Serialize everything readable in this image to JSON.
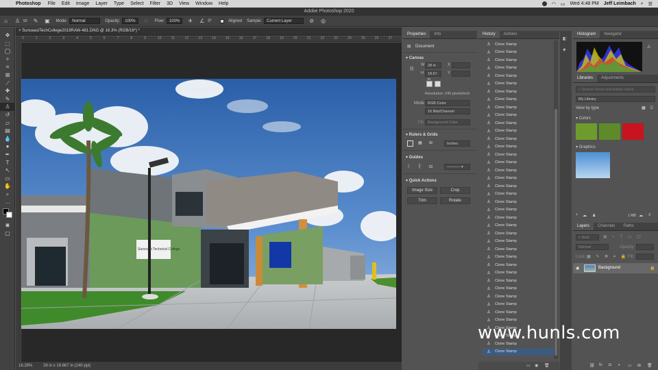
{
  "menubar": {
    "app": "Photoshop",
    "menus": [
      "File",
      "Edit",
      "Image",
      "Layer",
      "Type",
      "Select",
      "Filter",
      "3D",
      "View",
      "Window",
      "Help"
    ],
    "clock": "Wed 4:48 PM",
    "user": "Jeff Leimbach"
  },
  "window_title": "Adobe Photoshop 2020",
  "options": {
    "brush_size": "50",
    "mode_label": "Mode:",
    "mode_value": "Normal",
    "opacity_label": "Opacity:",
    "opacity_value": "100%",
    "flow_label": "Flow:",
    "flow_value": "100%",
    "angle_value": "0°",
    "aligned_label": "Aligned",
    "sample_label": "Sample:",
    "sample_value": "Current Layer"
  },
  "document": {
    "tab_title": "SunceastTechCollege2018RAW-481.DNG @ 16.3% (RGB/16*) *",
    "ruler_ticks": [
      "0",
      "1",
      "2",
      "3",
      "4",
      "5",
      "6",
      "7",
      "8",
      "9",
      "10",
      "11",
      "12",
      "13",
      "14",
      "15",
      "16",
      "17",
      "18",
      "19",
      "20",
      "21",
      "22",
      "23",
      "24",
      "25",
      "26",
      "27"
    ],
    "zoom": "16.28%",
    "size_info": "28 in x 18.667 in (240 ppi)",
    "sign_text": "Suncoast Technical College"
  },
  "properties": {
    "tabs": [
      "Properties",
      "Info"
    ],
    "doc_label": "Document",
    "canvas_title": "Canvas",
    "w_label": "W",
    "w_value": "28 in",
    "h_label": "H",
    "h_value": "18.67 in",
    "x_label": "X",
    "y_label": "Y",
    "resolution": "Resolution: 240 pixels/inch",
    "mode_label": "Mode",
    "mode_value": "RGB Color",
    "depth_value": "16 Bits/Channel",
    "fill_label": "Fill",
    "fill_value": "Background Color",
    "rulers_title": "Rulers & Grids",
    "units_value": "Inches",
    "guides_title": "Guides",
    "quick_title": "Quick Actions",
    "btn_image_size": "Image Size",
    "btn_crop": "Crop",
    "btn_trim": "Trim",
    "btn_rotate": "Rotate"
  },
  "history": {
    "tabs": [
      "History",
      "Actions"
    ],
    "items": [
      "Clone Stamp",
      "Clone Stamp",
      "Clone Stamp",
      "Clone Stamp",
      "Clone Stamp",
      "Clone Stamp",
      "Clone Stamp",
      "Clone Stamp",
      "Clone Stamp",
      "Clone Stamp",
      "Clone Stamp",
      "Clone Stamp",
      "Clone Stamp",
      "Clone Stamp",
      "Clone Stamp",
      "Clone Stamp",
      "Clone Stamp",
      "Clone Stamp",
      "Clone Stamp",
      "Clone Stamp",
      "Clone Stamp",
      "Clone Stamp",
      "Clone Stamp",
      "Clone Stamp",
      "Clone Stamp",
      "Clone Stamp",
      "Clone Stamp",
      "Clone Stamp",
      "Clone Stamp",
      "Clone Stamp",
      "Clone Stamp",
      "Clone Stamp",
      "Clone Stamp",
      "Clone Stamp",
      "Clone Stamp",
      "Clone Stamp",
      "Clone Stamp",
      "Clone Stamp",
      "Clone Stamp",
      "Clone Stamp"
    ]
  },
  "histogram": {
    "tabs": [
      "Histogram",
      "Navigator"
    ]
  },
  "libraries": {
    "tabs": [
      "Libraries",
      "Adjustments"
    ],
    "search_placeholder": "Search Stock and Adobe Stock",
    "library_name": "My Library",
    "view_by": "View by type",
    "colors_title": "Colors",
    "colors": [
      "#6f9b2c",
      "#5e8a2a",
      "#c8141e"
    ],
    "graphics_title": "Graphics",
    "storage": "1 MB"
  },
  "layers": {
    "tabs": [
      "Layers",
      "Channels",
      "Paths"
    ],
    "kind_placeholder": "Kind",
    "blend_value": "Normal",
    "opacity_label": "Opacity:",
    "lock_label": "Lock:",
    "fill_label": "Fill:",
    "layer_name": "Background"
  },
  "watermark": "www.hunls.com"
}
